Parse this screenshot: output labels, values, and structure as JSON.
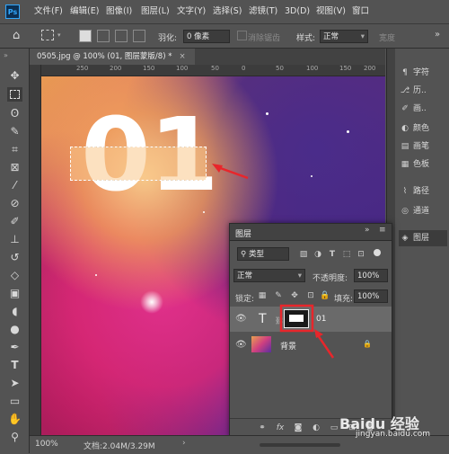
{
  "app": {
    "logo": "Ps"
  },
  "menu": [
    "文件(F)",
    "编辑(E)",
    "图像(I)",
    "图层(L)",
    "文字(Y)",
    "选择(S)",
    "滤镜(T)",
    "3D(D)",
    "视图(V)",
    "窗口"
  ],
  "options": {
    "feather_label": "羽化:",
    "feather_value": "0 像素",
    "antialias_label": "消除锯齿",
    "style_label": "样式:",
    "style_value": "正常",
    "width_label": "宽度"
  },
  "document": {
    "tab_title": "0505.jpg @ 100% (01, 图层蒙版/8) *",
    "ruler_marks": [
      "250",
      "200",
      "150",
      "100",
      "50",
      "0",
      "50",
      "100",
      "150",
      "200",
      "250"
    ],
    "canvas_text": "01"
  },
  "status": {
    "zoom": "100%",
    "doc_info": "文档:2.04M/3.29M"
  },
  "dock": {
    "items": [
      "字符",
      "历..",
      "画..",
      "颜色",
      "画笔",
      "色板",
      "路径",
      "通道",
      "图层"
    ]
  },
  "layers_panel": {
    "title": "图层",
    "filter_kind": "类型",
    "blend_mode": "正常",
    "opacity_label": "不透明度:",
    "opacity_value": "100%",
    "lock_label": "锁定:",
    "fill_label": "填充:",
    "fill_value": "100%",
    "layers": [
      {
        "name": "01",
        "type": "text"
      },
      {
        "name": "背景",
        "type": "image"
      }
    ]
  },
  "watermark": {
    "brand": "Baidu 经验",
    "url": "jingyan.baidu.com"
  },
  "colors": {
    "annotation": "#e8262b",
    "panel_bg": "#535353",
    "dark": "#3c3c3c"
  }
}
